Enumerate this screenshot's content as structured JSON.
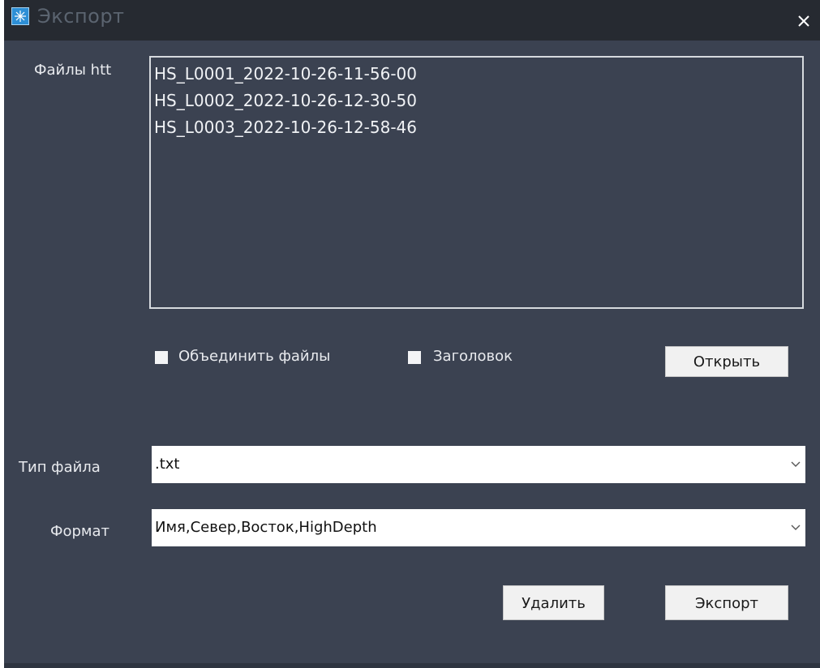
{
  "window": {
    "title": "Экспорт"
  },
  "files_section": {
    "label": "Файлы htt",
    "items": [
      "HS_L0001_2022-10-26-11-56-00",
      "HS_L0002_2022-10-26-12-30-50",
      "HS_L0003_2022-10-26-12-58-46"
    ]
  },
  "options": {
    "merge_files_label": "Объединить файлы",
    "merge_files_checked": false,
    "header_label": "Заголовок",
    "header_checked": false,
    "open_button": "Открыть"
  },
  "file_type": {
    "label": "Тип файла",
    "value": ".txt"
  },
  "format": {
    "label": "Формат",
    "value": "Имя,Север,Восток,HighDepth"
  },
  "actions": {
    "delete_button": "Удалить",
    "export_button": "Экспорт"
  },
  "icons": {
    "app": "app-icon",
    "close": "close-icon",
    "dropdown": "chevron-down-icon"
  }
}
